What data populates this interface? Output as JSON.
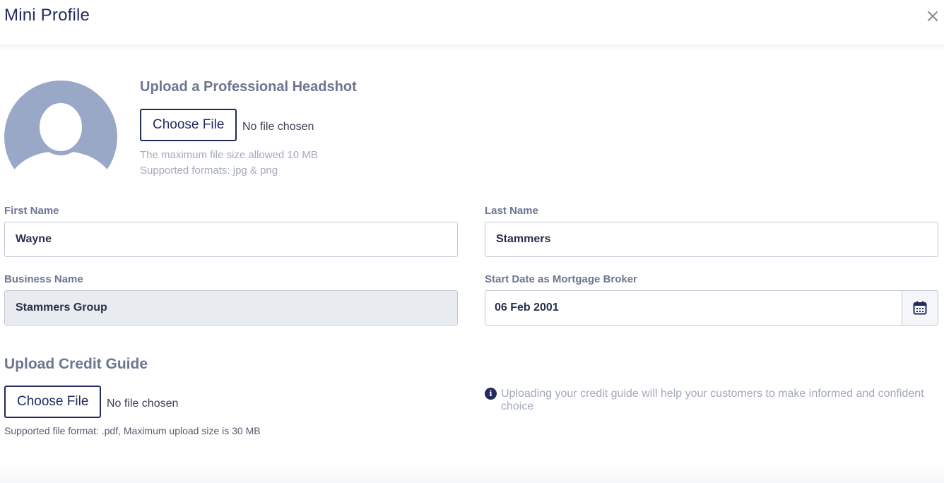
{
  "modal": {
    "title": "Mini Profile",
    "close_symbol": "×"
  },
  "headshot": {
    "title": "Upload a Professional Headshot",
    "button_label": "Choose File",
    "file_status": "No file chosen",
    "hint_size": "The maximum file size allowed 10 MB",
    "hint_formats": "Supported formats: jpg & png",
    "avatar_icon": "user-silhouette-icon"
  },
  "fields": {
    "first_name": {
      "label": "First Name",
      "value": "Wayne"
    },
    "last_name": {
      "label": "Last Name",
      "value": "Stammers"
    },
    "business_name": {
      "label": "Business Name",
      "value": "Stammers Group"
    },
    "start_date": {
      "label": "Start Date as Mortgage Broker",
      "value": "06 Feb 2001",
      "icon": "calendar-icon"
    }
  },
  "credit_guide": {
    "title": "Upload Credit Guide",
    "button_label": "Choose File",
    "file_status": "No file chosen",
    "note": "Supported file format: .pdf, Maximum upload size is 30 MB",
    "info_icon_label": "i",
    "info_text": "Uploading your credit guide will help your customers to make informed and confident choice"
  },
  "colors": {
    "primary": "#232a5c",
    "label": "#6d7591",
    "hint": "#a3a9bc",
    "avatar": "#9aa8c7"
  }
}
